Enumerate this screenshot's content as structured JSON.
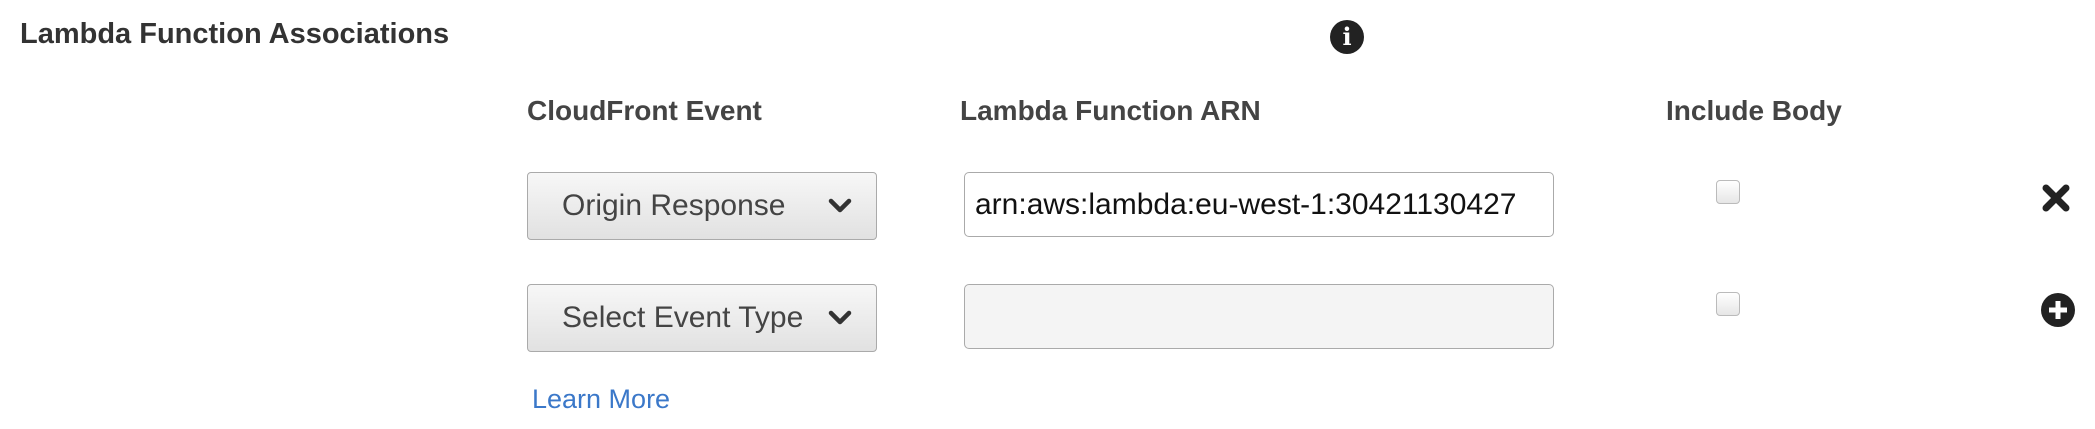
{
  "section": {
    "title": "Lambda Function Associations"
  },
  "columns": {
    "event": "CloudFront Event",
    "arn": "Lambda Function ARN",
    "include_body": "Include Body"
  },
  "rows": [
    {
      "event_value": "Origin Response",
      "arn_value": "arn:aws:lambda:eu-west-1:30421130427",
      "include_body": false,
      "action": "close-icon"
    },
    {
      "event_value": "Select Event Type",
      "arn_value": "",
      "include_body": false,
      "action": "plus-circle-icon"
    }
  ],
  "links": {
    "learn_more": "Learn More"
  },
  "colors": {
    "link": "#3b78c9",
    "icon": "#222222"
  }
}
